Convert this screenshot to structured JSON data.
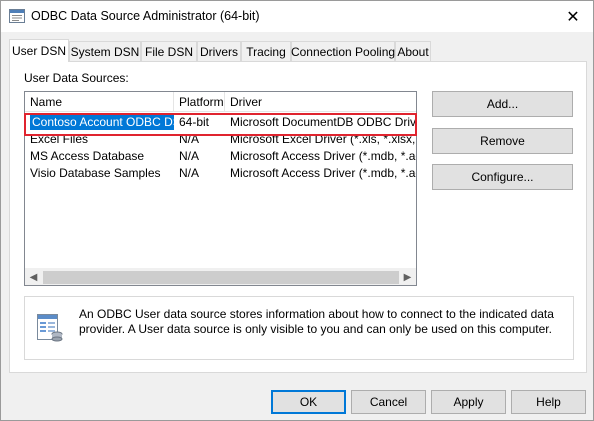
{
  "window": {
    "title": "ODBC Data Source Administrator (64-bit)",
    "close_glyph": "✕",
    "icon": "odbc-admin-icon"
  },
  "tabs": [
    {
      "label": "User DSN",
      "active": true
    },
    {
      "label": "System DSN",
      "active": false
    },
    {
      "label": "File DSN",
      "active": false
    },
    {
      "label": "Drivers",
      "active": false
    },
    {
      "label": "Tracing",
      "active": false
    },
    {
      "label": "Connection Pooling",
      "active": false
    },
    {
      "label": "About",
      "active": false
    }
  ],
  "user_dsn": {
    "section_label": "User Data Sources:",
    "columns": [
      "Name",
      "Platform",
      "Driver"
    ],
    "rows": [
      {
        "name": "Contoso Account ODBC DSN",
        "platform": "64-bit",
        "driver": "Microsoft DocumentDB ODBC Driver",
        "selected": true
      },
      {
        "name": "Excel Files",
        "platform": "N/A",
        "driver": "Microsoft Excel Driver (*.xls, *.xlsx, *.xlsm",
        "selected": false
      },
      {
        "name": "MS Access Database",
        "platform": "N/A",
        "driver": "Microsoft Access Driver (*.mdb, *.accdb)",
        "selected": false
      },
      {
        "name": "Visio Database Samples",
        "platform": "N/A",
        "driver": "Microsoft Access Driver (*.mdb, *.accdb)",
        "selected": false
      }
    ],
    "buttons": {
      "add": "Add...",
      "remove": "Remove",
      "configure": "Configure..."
    },
    "info_text": "An ODBC User data source stores information about how to connect to the indicated data provider.   A User data source is only visible to you and can only be used on this computer.",
    "info_icon": "data-source-info-icon"
  },
  "footer": {
    "ok": "OK",
    "cancel": "Cancel",
    "apply": "Apply",
    "help": "Help"
  },
  "colors": {
    "selection": "#0078d7",
    "highlight_box": "#e0242f",
    "default_button_border": "#0078d7"
  }
}
